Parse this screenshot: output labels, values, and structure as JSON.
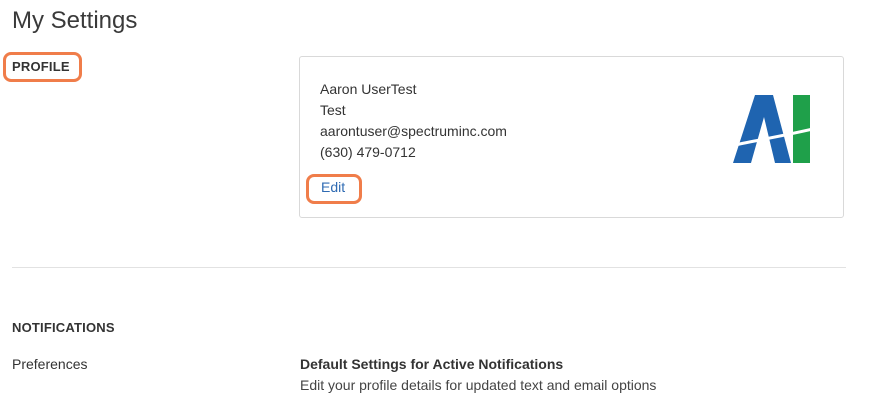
{
  "page": {
    "title": "My Settings"
  },
  "profile": {
    "section_label": "PROFILE",
    "name": "Aaron UserTest",
    "title": "Test",
    "email": "aarontuser@spectruminc.com",
    "phone": "(630) 479-0712",
    "edit_label": "Edit",
    "logo_text": "AI",
    "logo_colors": {
      "blue": "#1f64b0",
      "green": "#1fa04a"
    }
  },
  "notifications": {
    "section_label": "NOTIFICATIONS",
    "preferences_label": "Preferences",
    "default_heading": "Default Settings for Active Notifications",
    "default_description": "Edit your profile details for updated text and email options"
  },
  "colors": {
    "highlight_ring": "#f07d4a",
    "link": "#2f6bb3"
  }
}
